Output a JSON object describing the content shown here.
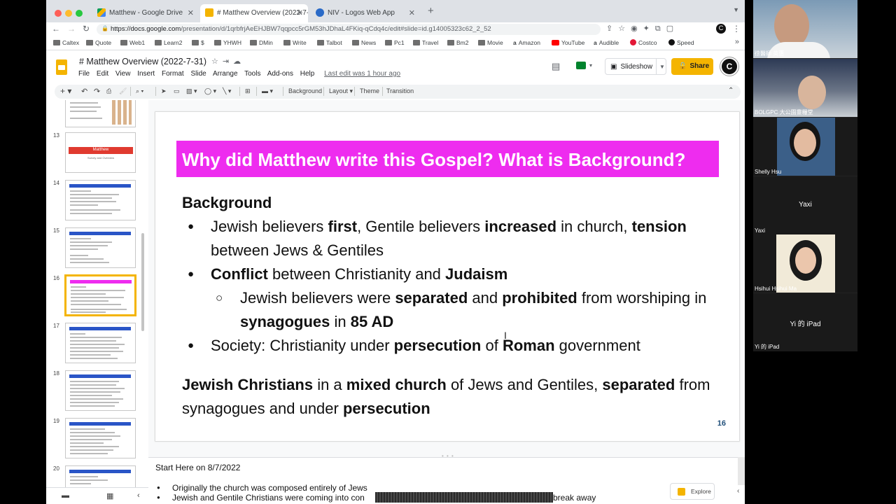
{
  "browser": {
    "tabs": [
      {
        "title": "Matthew - Google Drive",
        "icon": "google-drive-icon",
        "active": false
      },
      {
        "title": "# Matthew Overview (2022-7-",
        "icon": "google-slides-icon",
        "active": true
      },
      {
        "title": "NIV - Logos Web App",
        "icon": "logos-icon",
        "active": false
      }
    ],
    "url_domain": "https://docs.google.com",
    "url_path": "/presentation/d/1qrbfrjAeEHJBW7qqpcc5rGM53hJDhaL4FKiq-qCdq4c/edit#slide=id.g14005323c62_2_52",
    "bookmarks": [
      "Caltex",
      "Quote",
      "Web1",
      "Learn2",
      "$",
      "YHWH",
      "DMin",
      "Write",
      "Talbot",
      "News",
      "Pc1",
      "Travel",
      "Bm2",
      "Movie",
      "Amazon",
      "YouTube",
      "Audible",
      "Costco",
      "Speed"
    ]
  },
  "app": {
    "doc_title": "# Matthew Overview (2022-7-31)",
    "menus": [
      "File",
      "Edit",
      "View",
      "Insert",
      "Format",
      "Slide",
      "Arrange",
      "Tools",
      "Add-ons",
      "Help"
    ],
    "last_edit": "Last edit was 1 hour ago",
    "slideshow_label": "Slideshow",
    "share_label": "Share",
    "avatar_letter": "C",
    "toolbar": {
      "background": "Background",
      "layout": "Layout",
      "theme": "Theme",
      "transition": "Transition"
    }
  },
  "filmstrip": {
    "thumbs": [
      {
        "num": "13",
        "style": "title",
        "title": "Matthew",
        "subtitle": "Survey and Overview"
      },
      {
        "num": "14",
        "style": "list"
      },
      {
        "num": "15",
        "style": "list"
      },
      {
        "num": "16",
        "style": "list-pink",
        "selected": true
      },
      {
        "num": "17",
        "style": "list"
      },
      {
        "num": "18",
        "style": "list"
      },
      {
        "num": "19",
        "style": "list"
      },
      {
        "num": "20",
        "style": "list"
      }
    ]
  },
  "slide": {
    "title": "Why did Matthew write this Gospel? What is Background?",
    "title_bg": "#ee2cef",
    "heading": "Background",
    "bullet1": {
      "t1": "Jewish believers ",
      "b1": "first",
      "t2": ", Gentile believers ",
      "b2": "increased",
      "t3": " in church, ",
      "b3": "tension",
      "t4": " between Jews & Gentiles"
    },
    "bullet2": {
      "b1": "Conflict",
      "t1": " between Christianity and ",
      "b2": "Judaism"
    },
    "sub_bullet": {
      "t1": "Jewish believers were ",
      "b1": "separated",
      "t2": " and ",
      "b2": "prohibited",
      "t3": " from worshiping in ",
      "b3": "synagogues",
      "t4": " in ",
      "b4": "85 AD"
    },
    "bullet3": {
      "t1": "Society: Christianity under ",
      "b1": "persecution",
      "t2": " of ",
      "b2": "Roman",
      "t3": " government"
    },
    "summary": {
      "b1": "Jewish Christians",
      "t1": " in a ",
      "b2": "mixed church",
      "t2": " of Jews and Gentiles, ",
      "b3": "separated",
      "t3": " from synagogues and under ",
      "b4": "persecution"
    },
    "page_number": "16"
  },
  "notes": {
    "heading": "Start Here on 8/7/2022",
    "line1": "Originally the church was composed entirely of Jews",
    "line2_start": "Jewish and Gentile Christians were coming into con",
    "line2_end": "break away"
  },
  "explore_label": "Explore",
  "zoom": {
    "participants": [
      {
        "name": "徐醫師 英惠",
        "video": true
      },
      {
        "name": "BOLGPC 大公園靈糧堂",
        "video": true
      },
      {
        "name": "Shelly Hsu",
        "video": true
      },
      {
        "name": "Yaxi",
        "center": "Yaxi",
        "video": false
      },
      {
        "name": "Hsihui Hsihui Ma",
        "video": true
      },
      {
        "name": "Yi 的 iPad",
        "center": "Yi 的 iPad",
        "video": false
      }
    ]
  }
}
